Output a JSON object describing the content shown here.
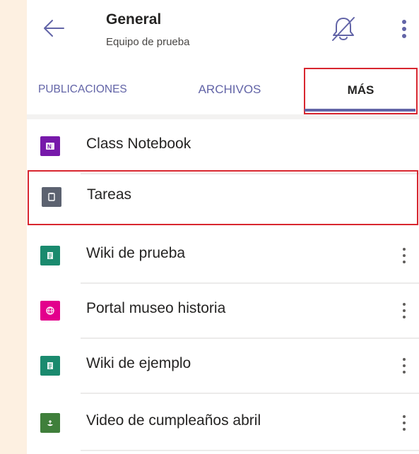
{
  "header": {
    "title": "General",
    "subtitle": "Equipo de prueba",
    "back_icon": "arrow-left-icon",
    "mute_icon": "bell-off-icon",
    "more_icon": "more-vertical-icon"
  },
  "tabs": [
    {
      "label": "PUBLICACIONES",
      "selected": false
    },
    {
      "label": "ARCHIVOS",
      "selected": false
    },
    {
      "label": "MÁS",
      "selected": true
    }
  ],
  "list": {
    "items": [
      {
        "label": "Class Notebook",
        "icon": "onenote-icon",
        "color": "#7719aa",
        "has_more": false
      },
      {
        "label": "Tareas",
        "icon": "assignments-icon",
        "color": "#5c6270",
        "has_more": false
      },
      {
        "label": "Wiki de prueba",
        "icon": "wiki-icon",
        "color": "#1a8a6e",
        "has_more": true
      },
      {
        "label": "Portal museo historia",
        "icon": "globe-icon",
        "color": "#e3008c",
        "has_more": true
      },
      {
        "label": "Wiki de ejemplo",
        "icon": "wiki-icon",
        "color": "#1a8a6e",
        "has_more": true
      },
      {
        "label": "Video de cumpleaños abril",
        "icon": "stream-icon",
        "color": "#3f7f3b",
        "has_more": true
      }
    ]
  },
  "colors": {
    "accent": "#6264a7",
    "highlight": "#d8262f",
    "background": "#fdf0e1"
  }
}
